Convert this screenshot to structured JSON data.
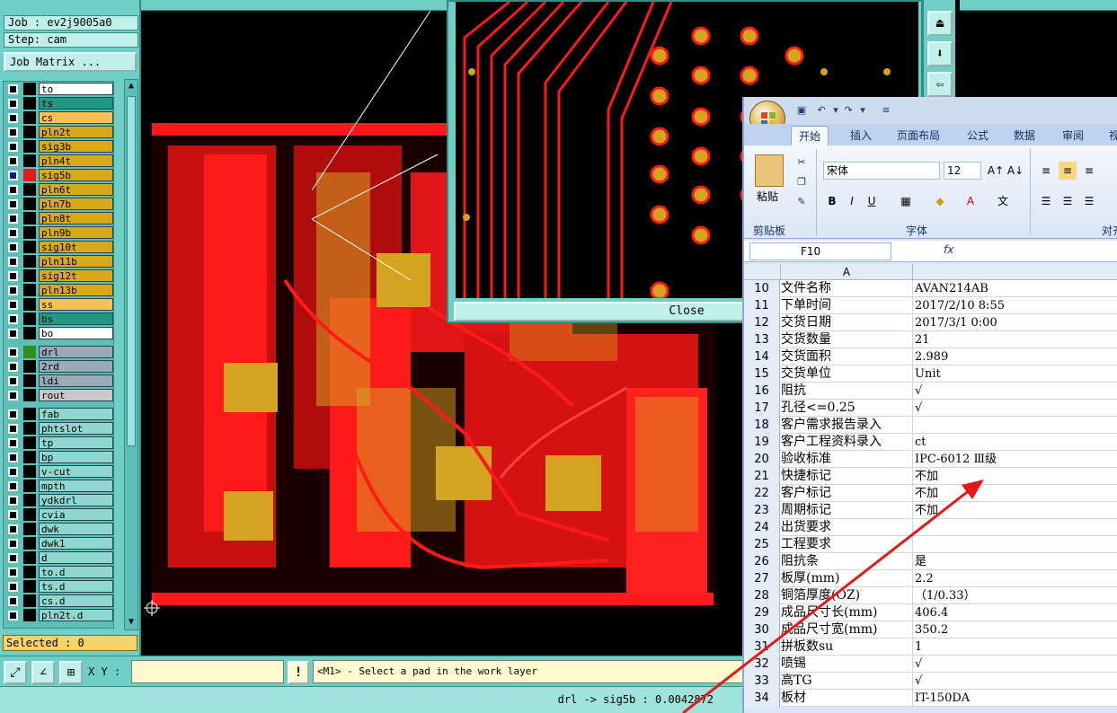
{
  "cam": {
    "job_label": "Job : ev2j9005a0",
    "step_label": "Step: cam",
    "job_matrix_button": "Job Matrix ...",
    "selected_label": "Selected : 0",
    "xy_label": "X Y :",
    "xy_value": "",
    "info_button": "!",
    "message": "<M1> - Select a pad in the work layer",
    "status": "drl -> sig5b : 0.0042872",
    "close_button": "Close",
    "layer_groups": [
      [
        {
          "name": "to",
          "color": "#ffffff",
          "active": false,
          "swatch": "#000000"
        },
        {
          "name": "ts",
          "color": "#1f9a82",
          "active": false,
          "swatch": "#000000"
        },
        {
          "name": "cs",
          "color": "#f6c255",
          "active": false,
          "swatch": "#000000"
        },
        {
          "name": "pln2t",
          "color": "#d8a918",
          "active": false,
          "swatch": "#000000"
        },
        {
          "name": "sig3b",
          "color": "#d8a918",
          "active": false,
          "swatch": "#000000"
        },
        {
          "name": "pln4t",
          "color": "#d8a918",
          "active": false,
          "swatch": "#000000"
        },
        {
          "name": "sig5b",
          "color": "#d8a918",
          "active": true,
          "swatch": "#e21c1c"
        },
        {
          "name": "pln6t",
          "color": "#d8a918",
          "active": false,
          "swatch": "#000000"
        },
        {
          "name": "pln7b",
          "color": "#d8a918",
          "active": false,
          "swatch": "#000000"
        },
        {
          "name": "pln8t",
          "color": "#d8a918",
          "active": false,
          "swatch": "#000000"
        },
        {
          "name": "pln9b",
          "color": "#d8a918",
          "active": false,
          "swatch": "#000000"
        },
        {
          "name": "sig10t",
          "color": "#d8a918",
          "active": false,
          "swatch": "#000000"
        },
        {
          "name": "pln11b",
          "color": "#d8a918",
          "active": false,
          "swatch": "#000000"
        },
        {
          "name": "sig12t",
          "color": "#d8a918",
          "active": false,
          "swatch": "#000000"
        },
        {
          "name": "pln13b",
          "color": "#d8a918",
          "active": false,
          "swatch": "#000000"
        },
        {
          "name": "ss",
          "color": "#f6c255",
          "active": false,
          "swatch": "#000000"
        },
        {
          "name": "bs",
          "color": "#1f9a82",
          "active": false,
          "swatch": "#000000"
        },
        {
          "name": "bo",
          "color": "#ffffff",
          "active": false,
          "swatch": "#000000"
        }
      ],
      [
        {
          "name": "drl",
          "color": "#9aa9b3",
          "active": false,
          "swatch": "#2f8f1f"
        },
        {
          "name": "2rd",
          "color": "#9aa9b3",
          "active": false,
          "swatch": "#000000"
        },
        {
          "name": "ldi",
          "color": "#9aa9b3",
          "active": false,
          "swatch": "#000000"
        },
        {
          "name": "rout",
          "color": "#c9c9c9",
          "active": false,
          "swatch": "#000000"
        }
      ],
      [
        {
          "name": "fab",
          "color": "#8fd7cf",
          "active": false,
          "swatch": "#000000"
        },
        {
          "name": "phtslot",
          "color": "#8fd7cf",
          "active": false,
          "swatch": "#000000"
        },
        {
          "name": "tp",
          "color": "#8fd7cf",
          "active": false,
          "swatch": "#000000"
        },
        {
          "name": "bp",
          "color": "#8fd7cf",
          "active": false,
          "swatch": "#000000"
        },
        {
          "name": "v-cut",
          "color": "#8fd7cf",
          "active": false,
          "swatch": "#000000"
        },
        {
          "name": "mpth",
          "color": "#8fd7cf",
          "active": false,
          "swatch": "#000000"
        },
        {
          "name": "ydkdrl",
          "color": "#8fd7cf",
          "active": false,
          "swatch": "#000000"
        },
        {
          "name": "cvia",
          "color": "#8fd7cf",
          "active": false,
          "swatch": "#000000"
        },
        {
          "name": "dwk",
          "color": "#8fd7cf",
          "active": false,
          "swatch": "#000000"
        },
        {
          "name": "dwk1",
          "color": "#8fd7cf",
          "active": false,
          "swatch": "#000000"
        },
        {
          "name": "d",
          "color": "#8fd7cf",
          "active": false,
          "swatch": "#000000"
        },
        {
          "name": "to.d",
          "color": "#8fd7cf",
          "active": false,
          "swatch": "#000000"
        },
        {
          "name": "ts.d",
          "color": "#8fd7cf",
          "active": false,
          "swatch": "#000000"
        },
        {
          "name": "cs.d",
          "color": "#8fd7cf",
          "active": false,
          "swatch": "#000000"
        },
        {
          "name": "pln2t.d",
          "color": "#8fd7cf",
          "active": false,
          "swatch": "#000000"
        }
      ]
    ],
    "colors": {
      "panel": "#6fcfc6",
      "trace": "#ff1a1a",
      "pad": "#d4a420"
    }
  },
  "excel": {
    "tabs": [
      "开始",
      "插入",
      "页面布局",
      "公式",
      "数据",
      "审阅",
      "视"
    ],
    "active_tab": "开始",
    "paste_label": "粘贴",
    "clipboard_group": "剪贴板",
    "font_group": "字体",
    "align_group": "对齐",
    "font_name": "宋体",
    "font_size": "12",
    "bold": "B",
    "italic": "I",
    "underline": "U",
    "name_box": "F10",
    "fx": "fx",
    "column_a": "A",
    "rows": [
      {
        "n": "10",
        "a": "文件名称",
        "b": "AVAN214AB"
      },
      {
        "n": "11",
        "a": "下单时间",
        "b": "2017/2/10 8:55"
      },
      {
        "n": "12",
        "a": "交货日期",
        "b": "2017/3/1 0:00"
      },
      {
        "n": "13",
        "a": "交货数量",
        "b": "21"
      },
      {
        "n": "14",
        "a": "交货面积",
        "b": "2.989"
      },
      {
        "n": "15",
        "a": "交货单位",
        "b": "Unit"
      },
      {
        "n": "16",
        "a": "阻抗",
        "b": "√"
      },
      {
        "n": "17",
        "a": "孔径<=0.25",
        "b": "√"
      },
      {
        "n": "18",
        "a": "客户需求报告录入",
        "b": ""
      },
      {
        "n": "19",
        "a": "客户工程资料录入",
        "b": "ct"
      },
      {
        "n": "20",
        "a": "验收标准",
        "b": "IPC-6012 Ⅲ级"
      },
      {
        "n": "21",
        "a": "快捷标记",
        "b": "不加"
      },
      {
        "n": "22",
        "a": "客户标记",
        "b": "不加"
      },
      {
        "n": "23",
        "a": "周期标记",
        "b": "不加"
      },
      {
        "n": "24",
        "a": "出货要求",
        "b": ""
      },
      {
        "n": "25",
        "a": "工程要求",
        "b": ""
      },
      {
        "n": "26",
        "a": "阻抗条",
        "b": "是"
      },
      {
        "n": "27",
        "a": "板厚(mm)",
        "b": "2.2"
      },
      {
        "n": "28",
        "a": "铜箔厚度(OZ)",
        "b": "（1/0.33）"
      },
      {
        "n": "29",
        "a": "成品尺寸长(mm)",
        "b": "406.4"
      },
      {
        "n": "30",
        "a": "成品尺寸宽(mm)",
        "b": "350.2"
      },
      {
        "n": "31",
        "a": "拼板数su",
        "b": "1"
      },
      {
        "n": "32",
        "a": "喷锡",
        "b": "√"
      },
      {
        "n": "33",
        "a": "高TG",
        "b": "√"
      },
      {
        "n": "34",
        "a": "板材",
        "b": "IT-150DA"
      }
    ]
  }
}
